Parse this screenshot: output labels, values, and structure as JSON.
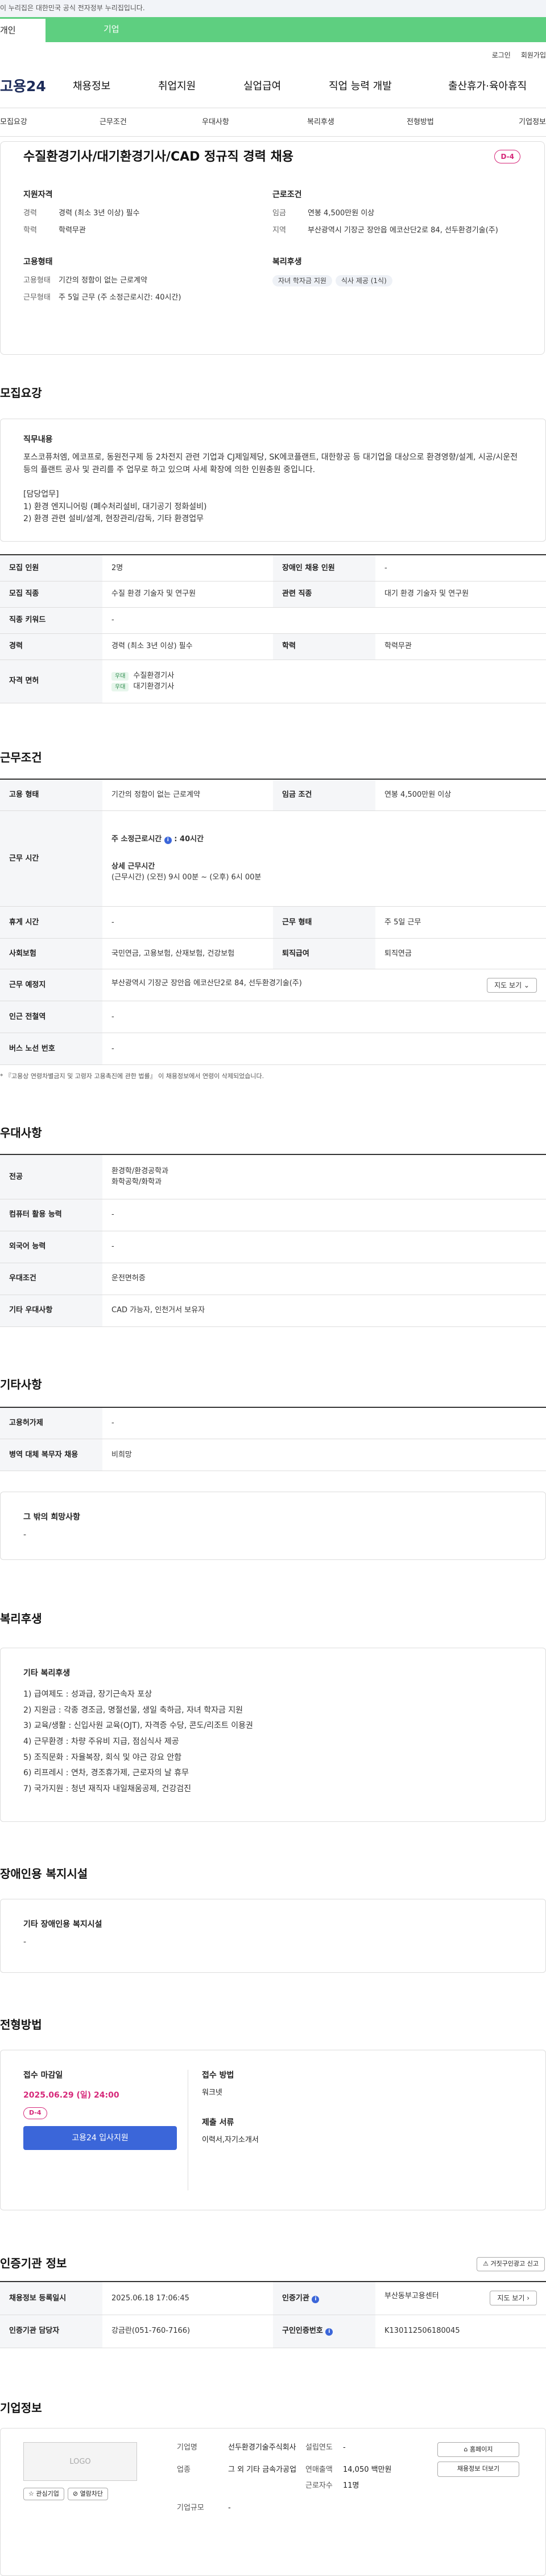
{
  "banner": "이 누리집은 대한민국 공식 전자정부 누리집입니다.",
  "tabs": {
    "t1": "개인",
    "t2": "기업"
  },
  "util": [
    "로그인",
    "회원가입"
  ],
  "gnb": {
    "logo": "고용24",
    "menu": [
      "채용정보",
      "취업지원",
      "실업급여",
      "직업 능력 개발",
      "출산휴가·육아휴직"
    ]
  },
  "lnb": [
    "모집요강",
    "근무조건",
    "우대사항",
    "복리후생",
    "전형방법",
    "기업정보"
  ],
  "job": {
    "title": "수질환경기사/대기환경기사/CAD 정규직 경력 채용",
    "dday": "D-4"
  },
  "summary": {
    "qual_h": "지원자격",
    "cond_h": "근로조건",
    "type_h": "고용형태",
    "welfare_h": "복리후생",
    "qual": [
      {
        "k": "경력",
        "v": "경력 (최소 3년 이상) 필수"
      },
      {
        "k": "학력",
        "v": "학력무관"
      }
    ],
    "cond": [
      {
        "k": "임금",
        "v": "연봉 4,500만원 이상"
      },
      {
        "k": "지역",
        "v": "부산광역시 기장군 장안읍 에코산단2로 84, 선두환경기술(주)"
      }
    ],
    "type": [
      {
        "k": "고용형태",
        "v": "기간의 정함이 없는 근로계약"
      },
      {
        "k": "근무형태",
        "v": "주 5일 근무 (주 소정근로시간: 40시간)"
      }
    ],
    "welfare": [
      "자녀 학자금 지원",
      "식사 제공 (1식)"
    ]
  },
  "recruit": {
    "title": "모집요강",
    "duty_h": "직무내용",
    "duty": "포스코퓨처엠, 에코프로, 동원전구제 등 2차전지 관련 기업과 CJ제일제당, SK에코플랜트, 대한항공 등 대기업을 대상으로 환경영향/설계, 시공/시운전 등의 플랜트 공사 및 관리를 주 업무로 하고 있으며 사세 확장에 의한 인원충원 중입니다.\n\n[담당업무]\n1) 환경 엔지니어링 (폐수처리설비, 대기공기 정화설비)\n2) 환경 관련 설비/설계, 현장관리/감독, 기타 환경업무",
    "rows": [
      {
        "k1": "모집 인원",
        "v1": "2명",
        "k2": "장애인 채용 인원",
        "v2": "-"
      },
      {
        "k1": "모집 직종",
        "v1": "수질 환경 기술자 및 연구원",
        "k2": "관련 직종",
        "v2": "대기 환경 기술자 및 연구원"
      },
      {
        "k1": "직종 키워드",
        "v1": "-"
      },
      {
        "k1": "경력",
        "v1": "경력 (최소 3년 이상) 필수",
        "k2": "학력",
        "v2": "학력무관"
      }
    ],
    "license_k": "자격 면허",
    "license_badge": "우대",
    "licenses": [
      "수질환경기사",
      "대기환경기사"
    ]
  },
  "work": {
    "title": "근무조건",
    "type_k": "고용 형태",
    "type_v": "기간의 정함이 없는 근로계약",
    "wage_k": "임금 조건",
    "wage_v": "연봉 4,500만원 이상",
    "time_k": "근무 시간",
    "time_a": "주 소정근로시간",
    "time_b": "40시간",
    "time_c": "상세 근무시간",
    "time_d": "(근무시간) (오전) 9시 00분 ~ (오후) 6시 00분",
    "rest_k": "휴게 시간",
    "rest_v": "-",
    "form_k": "근무 형태",
    "form_v": "주 5일 근무",
    "ins_k": "사회보험",
    "ins_v": "국민연금, 고용보험, 산재보험, 건강보험",
    "ret_k": "퇴직급여",
    "ret_v": "퇴직연금",
    "place_k": "근무 예정지",
    "place_v": "부산광역시 기장군 장안읍 에코산단2로 84, 선두환경기술(주)",
    "map_btn": "지도 보기 ⌄",
    "sub_k": "인근 전철역",
    "sub_v": "-",
    "bus_k": "버스 노선 번호",
    "bus_v": "-",
    "note": "* 『고용상 연령차별금지 및 고령자 고용촉진에 관한 법률』 이 채용정보에서 연령이 삭제되었습니다."
  },
  "pref": {
    "title": "우대사항",
    "rows": [
      {
        "k": "전공",
        "v": [
          "환경학/환경공학과",
          "화학공학/화학과"
        ]
      },
      {
        "k": "컴퓨터 활용 능력",
        "v": [
          "-"
        ]
      },
      {
        "k": "외국어 능력",
        "v": [
          "-"
        ]
      },
      {
        "k": "우대조건",
        "v": [
          "운전면허증"
        ]
      },
      {
        "k": "기타 우대사항",
        "v": [
          "CAD 가능자, 인천거서 보유자"
        ]
      }
    ]
  },
  "etc": {
    "title": "기타사항",
    "rows": [
      {
        "k": "고용허가제",
        "v": "-"
      },
      {
        "k": "병역 대체 복무자 채용",
        "v": "비희망"
      }
    ],
    "box_h": "그 밖의 희망사항",
    "box_v": "-"
  },
  "welfare": {
    "title": "복리후생",
    "box_h": "기타 복리후생",
    "items": [
      "1) 급여제도 : 성과급, 장기근속자 포상",
      "2) 지원금 : 각종 경조금, 명절선물, 생일 축하금, 자녀 학자금 지원",
      "3) 교육/생활 : 신입사원 교육(OJT), 자격증 수당, 콘도/리조트 이용권",
      "4) 근무환경 : 차량 주유비 지급, 점심식사 제공",
      "5) 조직문화 : 자율복장, 회식 및 야근 강요 안함",
      "6) 리프레시 : 연차, 경조휴가제, 근로자의 날 휴무",
      "7) 국가지원 : 청년 재직자 내일채움공제, 건강검진"
    ]
  },
  "disabled": {
    "title": "장애인용 복지시설",
    "box_h": "기타 장애인용 복지시설",
    "box_v": "-"
  },
  "apply": {
    "title": "전형방법",
    "deadline_h": "접수 마감일",
    "deadline": "2025.06.29 (일) 24:00",
    "dday": "D-4",
    "btn": "고용24 입사지원",
    "method_h": "접수 방법",
    "method_v": "워크넷",
    "docs_h": "제출 서류",
    "docs_v": "이력서,자기소개서"
  },
  "auth": {
    "title": "인증기관 정보",
    "report_btn": "⚠ 거짓구인광고 신고",
    "reg_k": "채용정보 등록일시",
    "reg_v": "2025.06.18 17:06:45",
    "org_k": "인증기관",
    "org_v": "부산동부고용센터",
    "map_btn": "지도 보기 ›",
    "staff_k": "인증기관 담당자",
    "staff_v": "강금란(051-760-7166)",
    "no_k": "구인인증번호",
    "no_v": "K130112506180045"
  },
  "company": {
    "title": "기업정보",
    "logo": "LOGO",
    "fav": "☆ 관심기업",
    "block": "⊘ 열람차단",
    "name_k": "기업명",
    "name_v": "선두환경기술주식회사",
    "year_k": "설립연도",
    "year_v": "-",
    "ind_k": "업종",
    "ind_v": "그 외 기타 금속가공업",
    "sales_k": "연매출액",
    "sales_v": "14,050 백만원",
    "size_k": "기업규모",
    "size_v": "-",
    "emp_k": "근로자수",
    "emp_v": "11명",
    "home_btn": "⌂ 홈페이지",
    "more_btn": "채용정보 더보기"
  },
  "colors": {
    "accent": "#5ecf80",
    "primary": "#3b66d9",
    "dday": "#d6287a"
  }
}
